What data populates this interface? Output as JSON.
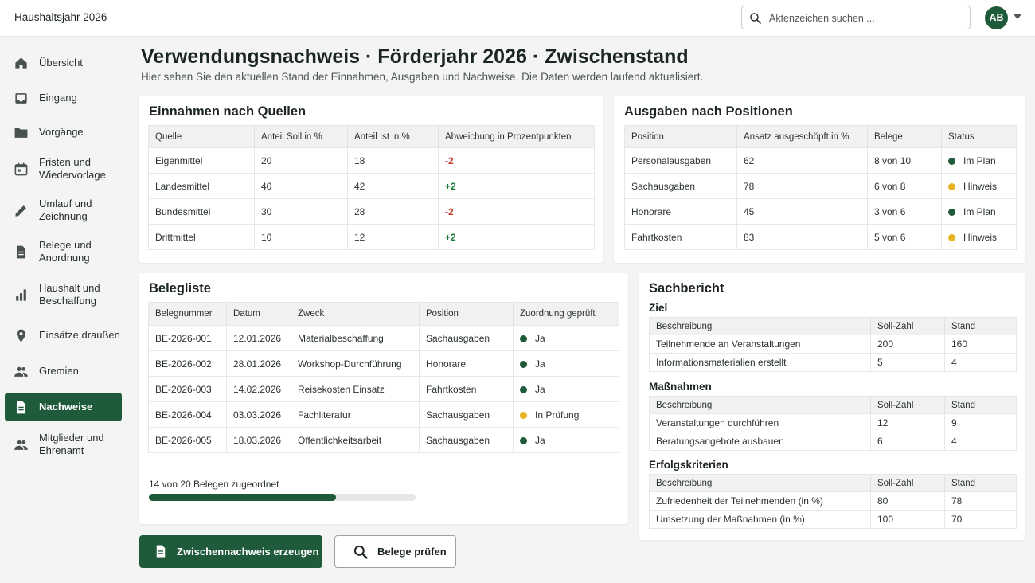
{
  "app": {
    "title": "Haushaltsjahr 2026"
  },
  "search": {
    "placeholder": "Aktenzeichen suchen ..."
  },
  "user": {
    "initials": "AB"
  },
  "colors": {
    "brand": "#1f5a3a",
    "ok": "#1f5a3a",
    "warn": "#e8b322",
    "neg": "#c0392b",
    "pos": "#1e7a3c"
  },
  "sidebar": {
    "items": [
      {
        "label": "Übersicht",
        "icon": "home-icon"
      },
      {
        "label": "Eingang",
        "icon": "inbox-icon"
      },
      {
        "label": "Vorgänge",
        "icon": "folder-icon"
      },
      {
        "label": "Fristen und Wiedervorlage",
        "icon": "calendar-icon"
      },
      {
        "label": "Umlauf und Zeichnung",
        "icon": "pencil-icon"
      },
      {
        "label": "Belege und Anordnung",
        "icon": "document-icon"
      },
      {
        "label": "Haushalt und Beschaffung",
        "icon": "bar-chart-icon"
      },
      {
        "label": "Einsätze draußen",
        "icon": "location-pin-icon"
      },
      {
        "label": "Gremien",
        "icon": "people-icon"
      },
      {
        "label": "Nachweise",
        "icon": "document-icon",
        "active": true
      },
      {
        "label": "Mitglieder und Ehrenamt",
        "icon": "people-icon"
      }
    ]
  },
  "page": {
    "title": "Verwendungsnachweis · Förderjahr 2026 · Zwischenstand",
    "subtitle": "Hier sehen Sie den aktuellen Stand der Einnahmen, Ausgaben und Nachweise. Die Daten werden laufend aktualisiert."
  },
  "einnahmen": {
    "title": "Einnahmen nach Quellen",
    "headers": [
      "Quelle",
      "Anteil Soll in %",
      "Anteil Ist in %",
      "Abweichung in Prozentpunkten"
    ],
    "rows": [
      {
        "quelle": "Eigenmittel",
        "soll": "20",
        "ist": "18",
        "abw": "-2",
        "sign": "neg"
      },
      {
        "quelle": "Landesmittel",
        "soll": "40",
        "ist": "42",
        "abw": "+2",
        "sign": "pos"
      },
      {
        "quelle": "Bundesmittel",
        "soll": "30",
        "ist": "28",
        "abw": "-2",
        "sign": "neg"
      },
      {
        "quelle": "Drittmittel",
        "soll": "10",
        "ist": "12",
        "abw": "+2",
        "sign": "pos"
      }
    ]
  },
  "ausgaben": {
    "title": "Ausgaben nach Positionen",
    "headers": [
      "Position",
      "Ansatz ausgeschöpft in %",
      "Belege",
      "Status"
    ],
    "rows": [
      {
        "position": "Personalausgaben",
        "ansatz": "62",
        "belege": "8 von 10",
        "status": "Im Plan",
        "state": "ok"
      },
      {
        "position": "Sachausgaben",
        "ansatz": "78",
        "belege": "6 von 8",
        "status": "Hinweis",
        "state": "warn"
      },
      {
        "position": "Honorare",
        "ansatz": "45",
        "belege": "3 von 6",
        "status": "Im Plan",
        "state": "ok"
      },
      {
        "position": "Fahrtkosten",
        "ansatz": "83",
        "belege": "5 von 6",
        "status": "Hinweis",
        "state": "warn"
      }
    ]
  },
  "belegliste": {
    "title": "Belegliste",
    "headers": [
      "Belegnummer",
      "Datum",
      "Zweck",
      "Position",
      "Zuordnung geprüft"
    ],
    "rows": [
      {
        "nr": "BE-2026-001",
        "datum": "12.01.2026",
        "zweck": "Materialbeschaffung",
        "position": "Sachausgaben",
        "geprueft": "Ja",
        "state": "ok"
      },
      {
        "nr": "BE-2026-002",
        "datum": "28.01.2026",
        "zweck": "Workshop-Durchführung",
        "position": "Honorare",
        "geprueft": "Ja",
        "state": "ok"
      },
      {
        "nr": "BE-2026-003",
        "datum": "14.02.2026",
        "zweck": "Reisekosten Einsatz",
        "position": "Fahrtkosten",
        "geprueft": "Ja",
        "state": "ok"
      },
      {
        "nr": "BE-2026-004",
        "datum": "03.03.2026",
        "zweck": "Fachliteratur",
        "position": "Sachausgaben",
        "geprueft": "In Prüfung",
        "state": "warn"
      },
      {
        "nr": "BE-2026-005",
        "datum": "18.03.2026",
        "zweck": "Öffentlichkeitsarbeit",
        "position": "Sachausgaben",
        "geprueft": "Ja",
        "state": "ok"
      }
    ],
    "progress": {
      "assigned": 14,
      "total": 20,
      "label": "14 von 20 Belegen zugeordnet"
    }
  },
  "sachbericht": {
    "title": "Sachbericht",
    "sections": [
      {
        "title": "Ziel",
        "headers": [
          "Beschreibung",
          "Soll-Zahl",
          "Stand"
        ],
        "rows": [
          [
            "Teilnehmende an Veranstaltungen",
            "200",
            "160"
          ],
          [
            "Informationsmaterialien erstellt",
            "5",
            "4"
          ]
        ]
      },
      {
        "title": "Maßnahmen",
        "headers": [
          "Beschreibung",
          "Soll-Zahl",
          "Stand"
        ],
        "rows": [
          [
            "Veranstaltungen durchführen",
            "12",
            "9"
          ],
          [
            "Beratungsangebote ausbauen",
            "6",
            "4"
          ]
        ]
      },
      {
        "title": "Erfolgskriterien",
        "headers": [
          "Beschreibung",
          "Soll-Zahl",
          "Stand"
        ],
        "rows": [
          [
            "Zufriedenheit der Teilnehmenden (in %)",
            "80",
            "78"
          ],
          [
            "Umsetzung der Maßnahmen (in %)",
            "100",
            "70"
          ]
        ]
      }
    ]
  },
  "actions": {
    "primary_label": "Zwischennachweis erzeugen",
    "secondary_label": "Belege prüfen"
  }
}
